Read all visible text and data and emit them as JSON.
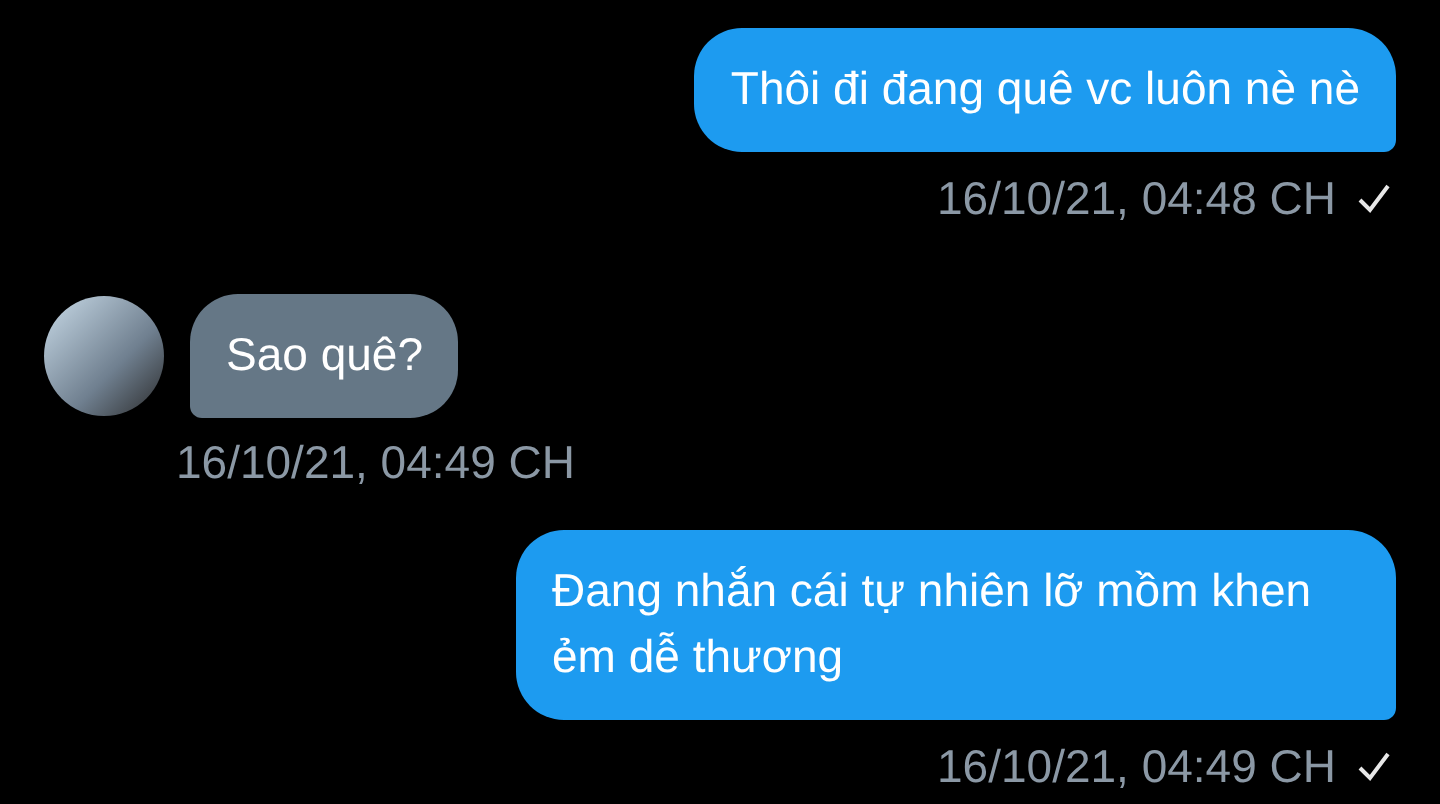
{
  "messages": [
    {
      "kind": "sent",
      "text": "Thôi đi đang quê vc luôn nè nè",
      "time": "16/10/21, 04:48 CH"
    },
    {
      "kind": "received",
      "text": "Sao quê?",
      "time": "16/10/21, 04:49 CH"
    },
    {
      "kind": "sent",
      "text": "Đang nhắn cái tự nhiên lỡ mồm khen ẻm dễ thương",
      "time": "16/10/21, 04:49 CH"
    }
  ]
}
